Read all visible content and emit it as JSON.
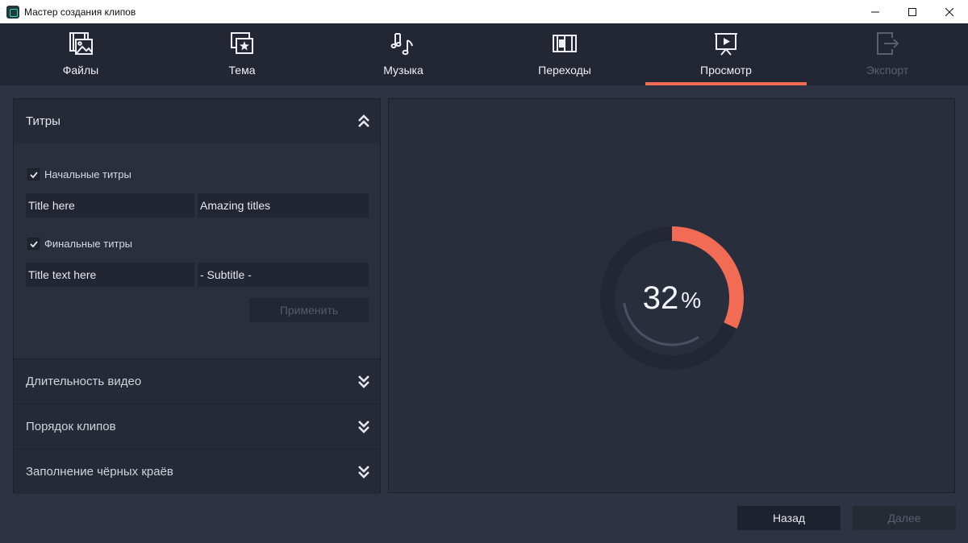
{
  "window": {
    "title": "Мастер создания клипов"
  },
  "nav": {
    "tabs": [
      {
        "label": "Файлы",
        "icon": "film-image-icon",
        "state": "normal"
      },
      {
        "label": "Тема",
        "icon": "star-card-icon",
        "state": "normal"
      },
      {
        "label": "Музыка",
        "icon": "music-note-icon",
        "state": "normal"
      },
      {
        "label": "Переходы",
        "icon": "film-transition-icon",
        "state": "normal"
      },
      {
        "label": "Просмотр",
        "icon": "presentation-play-icon",
        "state": "active"
      },
      {
        "label": "Экспорт",
        "icon": "export-icon",
        "state": "disabled"
      }
    ]
  },
  "titles_section": {
    "header": "Титры",
    "opening": {
      "label": "Начальные титры",
      "checked": true,
      "title_value": "Title here",
      "subtitle_value": "Amazing titles"
    },
    "closing": {
      "label": "Финальные титры",
      "checked": true,
      "title_value": "Title text here",
      "subtitle_value": "- Subtitle -"
    },
    "apply_label": "Применить"
  },
  "collapsed_sections": [
    {
      "label": "Длительность видео"
    },
    {
      "label": "Порядок клипов"
    },
    {
      "label": "Заполнение чёрных краёв"
    }
  ],
  "preview": {
    "progress_value": "32",
    "progress_unit": "%",
    "progress_fraction": 0.32
  },
  "footer": {
    "back_label": "Назад",
    "next_label": "Далее"
  },
  "colors": {
    "accent": "#f26b55",
    "background": "#2e3344",
    "panel": "#2a2f3d",
    "nav": "#232734"
  }
}
